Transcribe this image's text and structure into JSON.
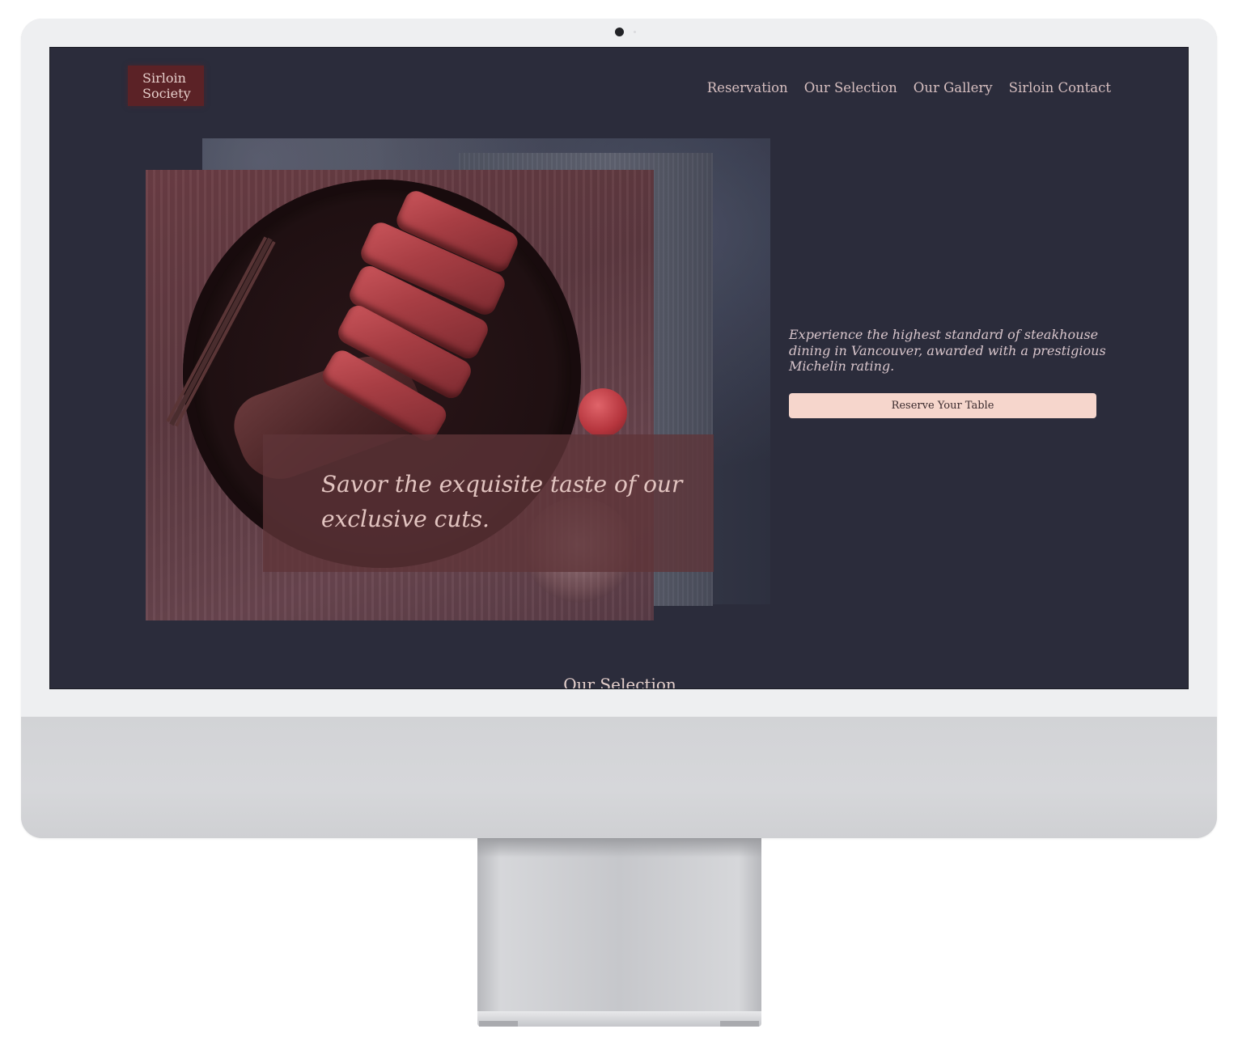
{
  "site": {
    "logo_line1": "Sirloin",
    "logo_line2": "Society"
  },
  "nav": {
    "items": [
      {
        "label": "Reservation"
      },
      {
        "label": "Our Selection"
      },
      {
        "label": "Our Gallery"
      },
      {
        "label": "Sirloin Contact"
      }
    ]
  },
  "hero": {
    "tagline": "Savor the exquisite taste of our exclusive cuts.",
    "blurb": "Experience the highest standard of steakhouse dining in Vancouver, awarded with a prestigious Michelin rating.",
    "cta_label": "Reserve Your Table"
  },
  "sections": {
    "next_heading": "Our Selection"
  },
  "colors": {
    "page_background": "#2b2c3b",
    "logo_background": "#5b2226",
    "cta_background": "#f6d6cc",
    "nav_text": "#d7bfc0",
    "device_frame": "#eeeff1"
  },
  "icons": {
    "camera": "webcam-dot"
  }
}
